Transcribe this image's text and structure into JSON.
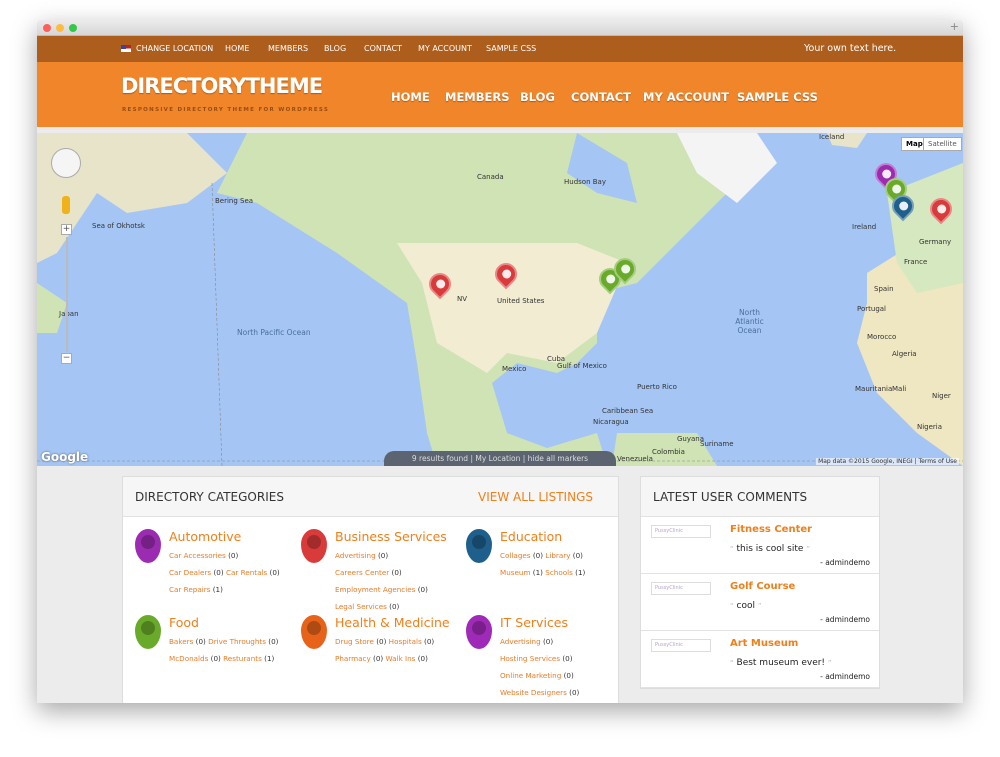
{
  "window": {
    "colors": {
      "close": "#fc605c",
      "min": "#fdbc40",
      "max": "#34c84a"
    }
  },
  "topbar": {
    "change_location": "CHANGE LOCATION",
    "items": [
      "HOME",
      "MEMBERS",
      "BLOG",
      "CONTACT",
      "MY ACCOUNT",
      "SAMPLE CSS"
    ],
    "right_text": "Your own text here."
  },
  "header": {
    "logo": "DIRECTORYTHEME",
    "tagline": "RESPONSIVE DIRECTORY THEME FOR WORDPRESS",
    "nav": [
      "HOME",
      "MEMBERS",
      "BLOG",
      "CONTACT",
      "MY ACCOUNT",
      "SAMPLE CSS"
    ],
    "colors": {
      "brand": "#f0852a",
      "topbar": "#ad5e1c"
    }
  },
  "map": {
    "type_buttons": [
      "Map",
      "Satellite"
    ],
    "labels": [
      "Iceland",
      "Canada",
      "Hudson Bay",
      "United States",
      "Mexico",
      "Cuba",
      "Gulf of Mexico",
      "Puerto Rico",
      "Caribbean Sea",
      "Nicaragua",
      "Venezuela",
      "Colombia",
      "Guyana",
      "Suriname",
      "Ireland",
      "Germany",
      "France",
      "Spain",
      "Portugal",
      "Morocco",
      "Algeria",
      "Mauritania",
      "Mali",
      "Niger",
      "Nigeria",
      "Sea of Okhotsk",
      "Bering Sea",
      "Japan",
      "NV"
    ],
    "oceans": [
      "North Pacific Ocean",
      "North Atlantic Ocean"
    ],
    "results_bar": "9 results found | My Location | hide all markers",
    "attribution": "Map data ©2015 Google, INEGI",
    "terms": "Terms of Use",
    "google": "Google",
    "zoom_in": "+",
    "zoom_out": "−"
  },
  "categories": {
    "title": "DIRECTORY CATEGORIES",
    "view_all": "VIEW ALL LISTINGS",
    "items": [
      {
        "name": "Automotive",
        "color": "#9b2bb0",
        "subs": [
          [
            "Car Accessories",
            "(0)"
          ],
          [
            "Car Dealers",
            "(0)"
          ],
          [
            "Car Rentals",
            "(0)"
          ],
          [
            "Car Repairs",
            "(1)"
          ]
        ]
      },
      {
        "name": "Business Services",
        "color": "#d93a3a",
        "subs": [
          [
            "Advertising",
            "(0)"
          ],
          [
            "Careers Center",
            "(0)"
          ],
          [
            "Employment Agencies",
            "(0)"
          ],
          [
            "Legal Services",
            "(0)"
          ]
        ]
      },
      {
        "name": "Education",
        "color": "#1f5f8b",
        "subs": [
          [
            "Collages",
            "(0)"
          ],
          [
            "Library",
            "(0)"
          ],
          [
            "Museum",
            "(1)"
          ],
          [
            "Schools",
            "(1)"
          ]
        ]
      },
      {
        "name": "Food",
        "color": "#6aaa2a",
        "subs": [
          [
            "Bakers",
            "(0)"
          ],
          [
            "Drive Throughts",
            "(0)"
          ],
          [
            "McDonalds",
            "(0)"
          ],
          [
            "Resturants",
            "(1)"
          ]
        ]
      },
      {
        "name": "Health & Medicine",
        "color": "#e8631a",
        "subs": [
          [
            "Drug Store",
            "(0)"
          ],
          [
            "Hospitals",
            "(0)"
          ],
          [
            "Pharmacy",
            "(0)"
          ],
          [
            "Walk Ins",
            "(0)"
          ]
        ]
      },
      {
        "name": "IT Services",
        "color": "#a02ab8",
        "subs": [
          [
            "Advertising",
            "(0)"
          ],
          [
            "Hosting Services",
            "(0)"
          ],
          [
            "Online Marketing",
            "(0)"
          ],
          [
            "Website Designers",
            "(0)"
          ]
        ]
      }
    ]
  },
  "comments": {
    "title": "LATEST USER COMMENTS",
    "avatar_text": "PussyClinic",
    "items": [
      {
        "title": "Fitness Center",
        "text": "this is cool site",
        "user": "- admindemo"
      },
      {
        "title": "Golf Course",
        "text": "cool",
        "user": "- admindemo"
      },
      {
        "title": "Art Museum",
        "text": "Best museum ever!",
        "user": "- admindemo"
      }
    ]
  }
}
